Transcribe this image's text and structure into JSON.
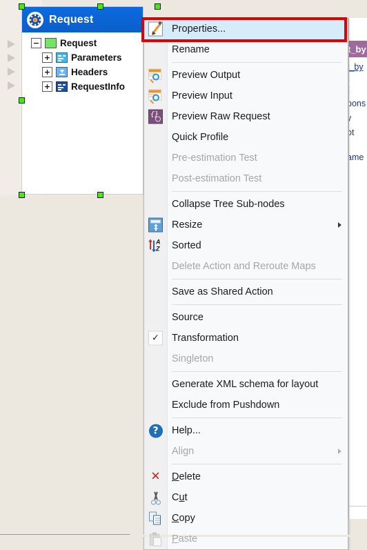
{
  "canvas": {
    "background_color": "#ece8df",
    "node": {
      "title": "Request",
      "title_icon": "gear-icon",
      "title_bar_color": "#0a63d6",
      "tree": [
        {
          "label": "Request",
          "expander": "−",
          "icon": "green-square-icon",
          "depth": 0
        },
        {
          "label": "Parameters",
          "expander": "+",
          "icon": "light-blue-list-icon",
          "depth": 1
        },
        {
          "label": "Headers",
          "expander": "+",
          "icon": "blue-download-icon",
          "depth": 1
        },
        {
          "label": "RequestInfo",
          "expander": "+",
          "icon": "dark-blue-list-icon",
          "depth": 1
        }
      ],
      "selection_handle_color": "#4ee31a"
    },
    "ports": [
      {
        "name": "input-port-1"
      },
      {
        "name": "input-port-2"
      },
      {
        "name": "input-port-3"
      },
      {
        "name": "input-port-4"
      }
    ]
  },
  "right_panel": {
    "header_color": "#9c6d9c",
    "header_text": "t_by",
    "lines": [
      {
        "text": "t_by",
        "link": true
      },
      {
        "text": "t"
      },
      {
        "text": "pons"
      },
      {
        "text": "y"
      },
      {
        "text": "ot"
      },
      {
        "text": "ame"
      }
    ]
  },
  "annotation": {
    "highlight_color": "#e00000",
    "target": "Properties..."
  },
  "context_menu": {
    "items": [
      {
        "label": "Properties...",
        "icon": "edit-properties-icon",
        "enabled": true,
        "selected": true,
        "type": "item"
      },
      {
        "label": "Rename",
        "icon": null,
        "enabled": true,
        "selected": false,
        "type": "item"
      },
      {
        "type": "separator"
      },
      {
        "label": "Preview Output",
        "icon": "preview-output-icon",
        "enabled": true,
        "selected": false,
        "type": "item"
      },
      {
        "label": "Preview Input",
        "icon": "preview-input-icon",
        "enabled": true,
        "selected": false,
        "type": "item"
      },
      {
        "label": "Preview Raw Request",
        "icon": "preview-raw-icon",
        "enabled": true,
        "selected": false,
        "type": "item"
      },
      {
        "label": "Quick Profile",
        "icon": null,
        "enabled": true,
        "selected": false,
        "type": "item"
      },
      {
        "label": "Pre-estimation Test",
        "icon": null,
        "enabled": false,
        "selected": false,
        "type": "item"
      },
      {
        "label": "Post-estimation Test",
        "icon": null,
        "enabled": false,
        "selected": false,
        "type": "item"
      },
      {
        "type": "separator"
      },
      {
        "label": "Collapse Tree Sub-nodes",
        "icon": null,
        "enabled": true,
        "selected": false,
        "type": "item"
      },
      {
        "label": "Resize",
        "icon": "resize-icon",
        "enabled": true,
        "selected": false,
        "type": "item",
        "submenu": true
      },
      {
        "label": "Sorted",
        "icon": "sort-az-icon",
        "enabled": true,
        "selected": false,
        "type": "item"
      },
      {
        "label": "Delete Action and Reroute Maps",
        "icon": null,
        "enabled": false,
        "selected": false,
        "type": "item"
      },
      {
        "type": "separator"
      },
      {
        "label": "Save as Shared Action",
        "icon": null,
        "enabled": true,
        "selected": false,
        "type": "item"
      },
      {
        "type": "separator"
      },
      {
        "label": "Source",
        "icon": null,
        "enabled": true,
        "selected": false,
        "type": "item"
      },
      {
        "label": "Transformation",
        "icon": "check-icon",
        "enabled": true,
        "selected": false,
        "type": "item",
        "checked": true
      },
      {
        "label": "Singleton",
        "icon": null,
        "enabled": false,
        "selected": false,
        "type": "item"
      },
      {
        "type": "separator"
      },
      {
        "label": "Generate XML schema for layout",
        "icon": null,
        "enabled": true,
        "selected": false,
        "type": "item"
      },
      {
        "label": "Exclude from Pushdown",
        "icon": null,
        "enabled": true,
        "selected": false,
        "type": "item"
      },
      {
        "type": "separator"
      },
      {
        "label": "Help...",
        "icon": "help-icon",
        "enabled": true,
        "selected": false,
        "type": "item"
      },
      {
        "label": "Align",
        "icon": null,
        "enabled": false,
        "selected": false,
        "type": "item",
        "submenu": true
      },
      {
        "type": "separator"
      },
      {
        "label": "Delete",
        "icon": "delete-x-icon",
        "enabled": true,
        "selected": false,
        "type": "item",
        "mnemonic": "D"
      },
      {
        "label": "Cut",
        "icon": "scissors-icon",
        "enabled": true,
        "selected": false,
        "type": "item",
        "mnemonic": "u"
      },
      {
        "label": "Copy",
        "icon": "copy-icon",
        "enabled": true,
        "selected": false,
        "type": "item",
        "mnemonic": "C"
      },
      {
        "label": "Paste",
        "icon": "paste-icon",
        "enabled": false,
        "selected": false,
        "type": "item",
        "mnemonic": "P"
      }
    ]
  }
}
